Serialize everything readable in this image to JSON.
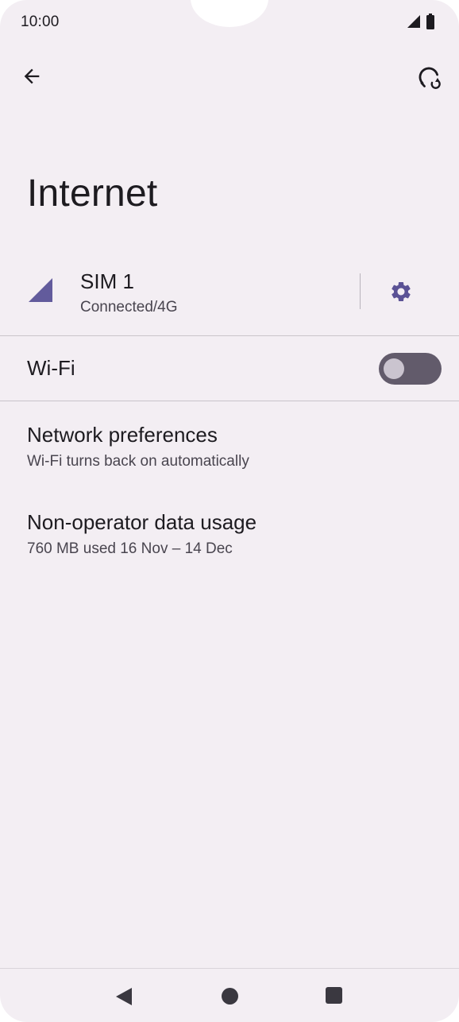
{
  "status_bar": {
    "time": "10:00"
  },
  "page": {
    "title": "Internet"
  },
  "sim": {
    "name": "SIM 1",
    "status": "Connected/4G"
  },
  "wifi": {
    "label": "Wi-Fi",
    "enabled": false
  },
  "network_preferences": {
    "title": "Network preferences",
    "subtitle": "Wi-Fi turns back on automatically"
  },
  "non_operator": {
    "title": "Non-operator data usage",
    "subtitle": "760 MB used 16 Nov – 14 Dec"
  },
  "icons": {
    "back": "arrow-left-icon",
    "refresh": "network-reset-icon",
    "signal": "signal-icon",
    "settings": "gear-icon",
    "nav_back": "triangle-back-icon",
    "nav_home": "circle-home-icon",
    "nav_recents": "square-recents-icon"
  },
  "colors": {
    "accent": "#625b9c",
    "toggle_track": "#625b6b",
    "background": "#f3eef3"
  }
}
